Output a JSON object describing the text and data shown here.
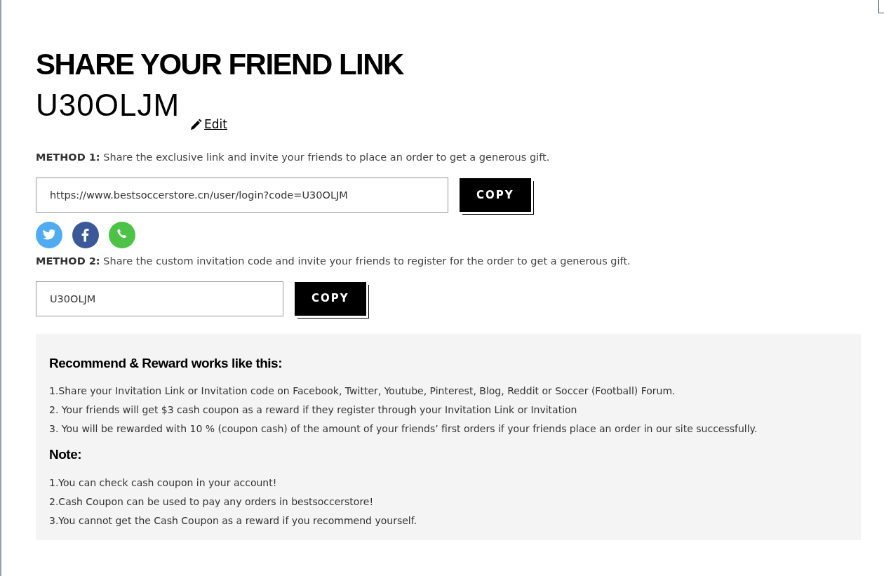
{
  "title": "SHARE YOUR FRIEND LINK",
  "code": "U30OLJM",
  "edit_link": "Edit",
  "methods": [
    {
      "text": "**METHOD 1:** Share the exclusive link and invite your friends to place an order to get a generous gift.",
      "field_value": "https://www.bestsoccerstore.cn/user/login?code=U30OLJM",
      "button": "COPY",
      "share": [
        {
          "kind": "twitter"
        },
        {
          "kind": "facebook"
        },
        {
          "kind": "whatsapp"
        }
      ]
    },
    {
      "text": "**METHOD 2:** Share the custom invitation code and invite your friends to register for the order to get a generous gift.",
      "field_value": "U30OLJM",
      "button": "COPY"
    }
  ],
  "info": [
    {
      "heading": "Recommend & Reward works like this:",
      "lines": [
        "1.Share your Invitation Link or Invitation code on Facebook, Twitter, Youtube, Pinterest, Blog, Reddit or Soccer (Football) Forum.",
        "2. Your friends will get $3 cash coupon as a reward if they register through your Invitation Link or Invitation",
        "3. You will be rewarded with 10 % (coupon cash) of the amount of your friends’ first orders if your friends place an order in our site successfully."
      ]
    },
    {
      "heading": "Note:",
      "lines": [
        "1.You can check cash coupon in your account!",
        "2.Cash Coupon can be used to pay any orders in bestsoccerstore!",
        "3.You cannot get the Cash Coupon as a reward if you recommend yourself."
      ]
    }
  ]
}
